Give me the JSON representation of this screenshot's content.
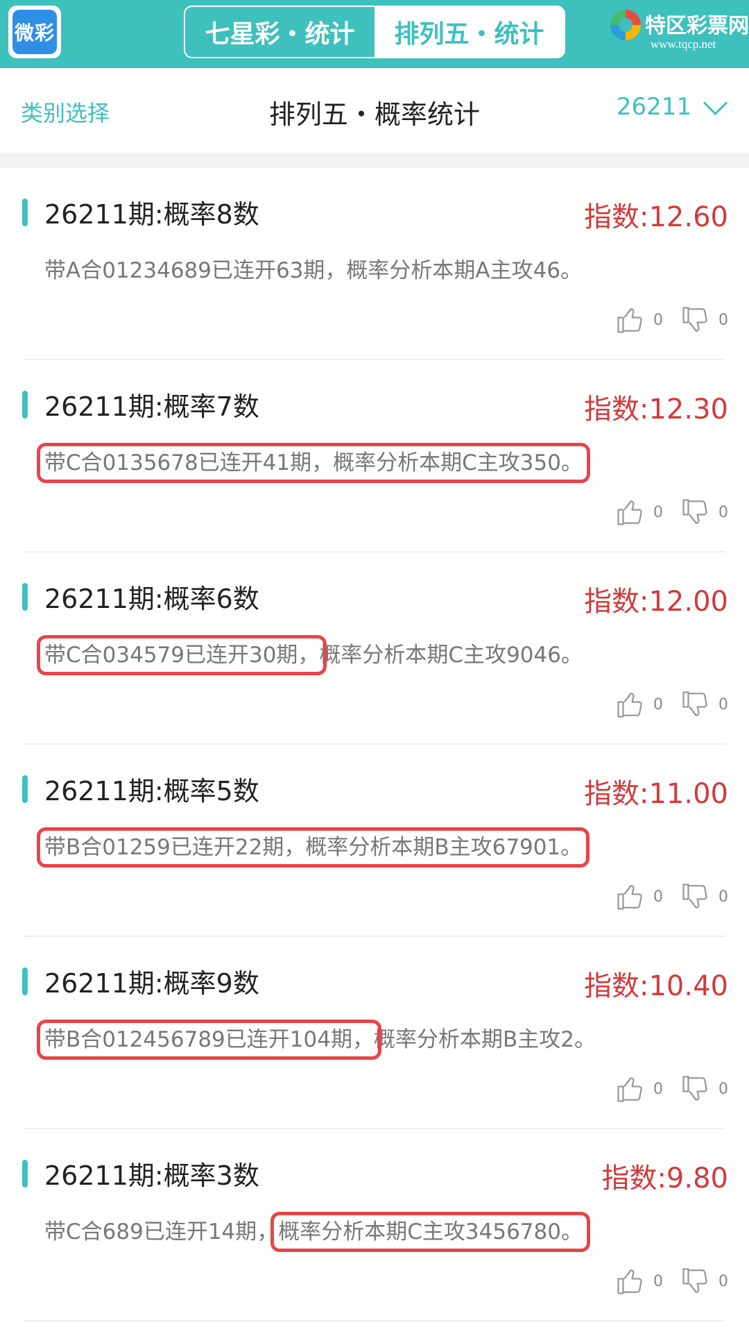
{
  "topbar": {
    "app_logo": "微彩",
    "tabs": [
      {
        "label": "七星彩・统计",
        "active": false
      },
      {
        "label": "排列五・统计",
        "active": true
      }
    ],
    "site_logo": {
      "name": "特区彩票网",
      "url": "www.tqcp.net"
    }
  },
  "header": {
    "category_label": "类别选择",
    "title": "排列五・概率统计",
    "issue": "26211"
  },
  "cards": [
    {
      "title": "26211期:概率8数",
      "index": "指数:12.60",
      "desc_a": "带A合01234689已连开63期，概率分析本期A主攻46",
      "desc_b": "",
      "tail": "。",
      "up": "0",
      "down": "0"
    },
    {
      "title": "26211期:概率7数",
      "index": "指数:12.30",
      "desc_a": "带C合0135678已连开41期，概率分析本期C主攻350",
      "desc_b": "",
      "tail": "。",
      "up": "0",
      "down": "0"
    },
    {
      "title": "26211期:概率6数",
      "index": "指数:12.00",
      "desc_a": "带C合034579已连开30期，",
      "desc_b": "概率分析本期C主攻9046",
      "tail": "。",
      "up": "0",
      "down": "0"
    },
    {
      "title": "26211期:概率5数",
      "index": "指数:11.00",
      "desc_a": "带B合01259已连开22期，概率分析本期B主攻67901",
      "desc_b": "",
      "tail": "。",
      "up": "0",
      "down": "0"
    },
    {
      "title": "26211期:概率9数",
      "index": "指数:10.40",
      "desc_a": "带B合012456789已连开104期，",
      "desc_b": "概率分析本期B主攻2",
      "tail": "。",
      "up": "0",
      "down": "0"
    },
    {
      "title": "26211期:概率3数",
      "index": "指数:9.80",
      "desc_a": "带C合689已连开14期，",
      "desc_b": "概率分析本期C主攻3456780",
      "tail": "。",
      "up": "0",
      "down": "0"
    }
  ],
  "colors": {
    "accent": "#3ec0bd",
    "index_red": "#d23a3a",
    "highlight_box": "#e8444a"
  }
}
